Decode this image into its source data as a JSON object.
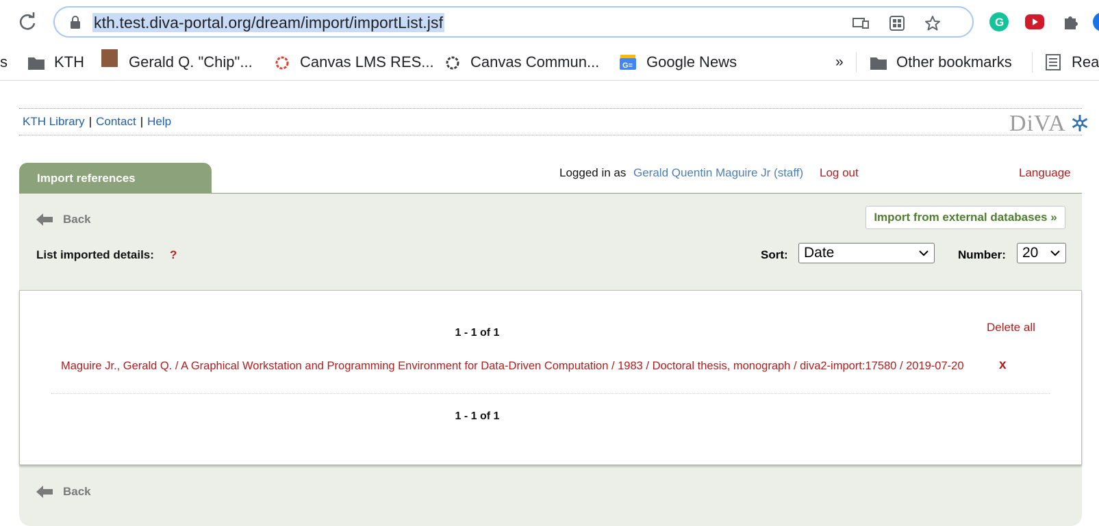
{
  "browser": {
    "url": "kth.test.diva-portal.org/dream/import/importList.jsf",
    "bookmarks": [
      {
        "label": "s"
      },
      {
        "label": "KTH"
      },
      {
        "label": "Gerald Q. \"Chip\"..."
      },
      {
        "label": "Canvas LMS RES..."
      },
      {
        "label": "Canvas Commun..."
      },
      {
        "label": "Google News"
      },
      {
        "label": "»"
      },
      {
        "label": "Other bookmarks"
      },
      {
        "label": "Rea"
      }
    ]
  },
  "header": {
    "links": [
      "KTH Library",
      "Contact",
      "Help"
    ],
    "separator": "|",
    "logo": "DiVA"
  },
  "tab": {
    "label": "Import references"
  },
  "login": {
    "prefix": "Logged in as",
    "user": "Gerald Quentin Maguire Jr (staff)",
    "logout": "Log out",
    "language": "Language"
  },
  "controls": {
    "back": "Back",
    "import_button": "Import from external databases »",
    "list_label": "List imported details:",
    "help": "?",
    "sort_label": "Sort:",
    "sort_value": "Date",
    "number_label": "Number:",
    "number_value": "20"
  },
  "results": {
    "pager_top": "1 - 1 of 1",
    "pager_bottom": "1 - 1 of 1",
    "delete_all": "Delete all",
    "delete_item": "x",
    "items": [
      {
        "text": "Maguire Jr., Gerald Q. / A Graphical Workstation and Programming Environment for Data-Driven Computation / 1983 / Doctoral thesis, monograph / diva2-import:17580 / 2019-07-20"
      }
    ]
  },
  "colors": {
    "tab_green": "#8ca27a",
    "panel_bg": "#eceee8",
    "link_blue": "#1f5fa8",
    "red": "#b01e1e",
    "import_green": "#4f7f2e"
  }
}
